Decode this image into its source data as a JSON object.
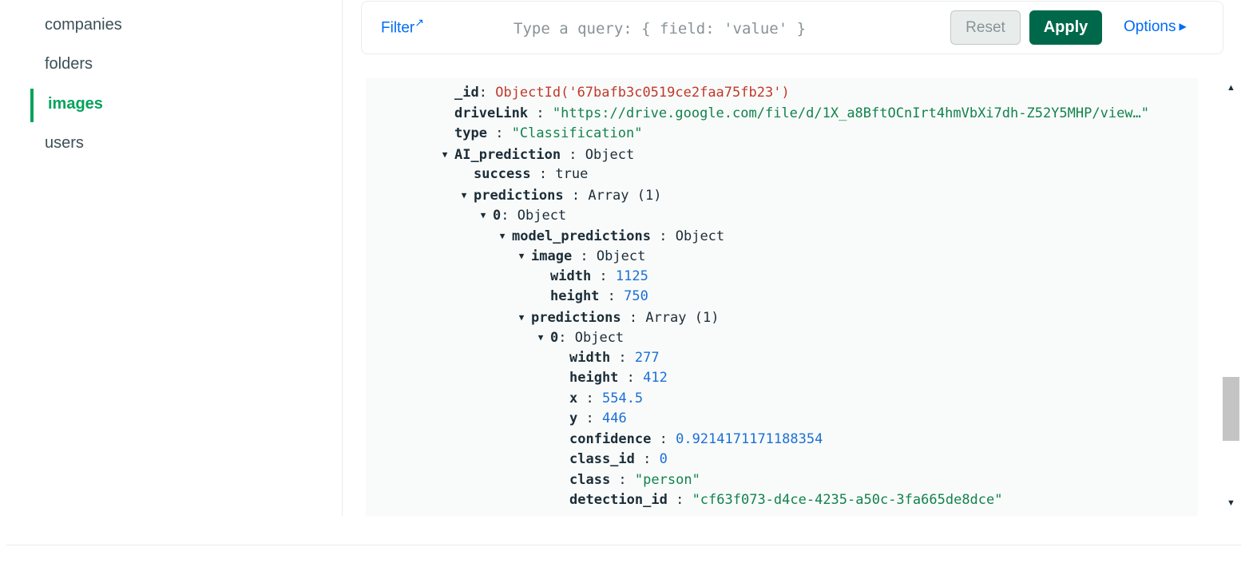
{
  "sidebar": {
    "items": [
      {
        "label": "companies",
        "active": false
      },
      {
        "label": "folders",
        "active": false
      },
      {
        "label": "images",
        "active": true
      },
      {
        "label": "users",
        "active": false
      }
    ]
  },
  "filter": {
    "link_label": "Filter",
    "placeholder": "Type a query: { field: 'value' }",
    "reset_label": "Reset",
    "apply_label": "Apply",
    "options_label": "Options"
  },
  "colors": {
    "accent_green": "#00a35c",
    "apply_green": "#00684a",
    "link_blue": "#016bf8",
    "string_green": "#12824d",
    "number_blue": "#1b6fd6",
    "objectid_red": "#c0392b"
  },
  "document": {
    "lines": [
      {
        "key": "_id",
        "sep": ":",
        "value": "ObjectId('67bafb3c0519ce2faa75fb23')",
        "vtype": "oid",
        "indent": 0,
        "caret": false
      },
      {
        "key": "driveLink",
        "sep": " :",
        "value": "\"https://drive.google.com/file/d/1X_a8BftOCnIrt4hmVbXi7dh-Z52Y5MHP/view…\"",
        "vtype": "str",
        "indent": 0,
        "caret": false
      },
      {
        "key": "type",
        "sep": " :",
        "value": "\"Classification\"",
        "vtype": "str",
        "indent": 0,
        "caret": false
      },
      {
        "key": "AI_prediction",
        "sep": " :",
        "value": "Object",
        "vtype": "plain",
        "indent": 0,
        "caret": true
      },
      {
        "key": "success",
        "sep": " :",
        "value": "true",
        "vtype": "plain",
        "indent": 1,
        "caret": false
      },
      {
        "key": "predictions",
        "sep": " :",
        "value": "Array (1)",
        "vtype": "plain",
        "indent": 1,
        "caret": true
      },
      {
        "key": "0",
        "sep": ":",
        "value": "Object",
        "vtype": "plain",
        "indent": 2,
        "caret": true
      },
      {
        "key": "model_predictions",
        "sep": " :",
        "value": "Object",
        "vtype": "plain",
        "indent": 3,
        "caret": true
      },
      {
        "key": "image",
        "sep": " :",
        "value": "Object",
        "vtype": "plain",
        "indent": 4,
        "caret": true
      },
      {
        "key": "width",
        "sep": " :",
        "value": "1125",
        "vtype": "num",
        "indent": 5,
        "caret": false
      },
      {
        "key": "height",
        "sep": " :",
        "value": "750",
        "vtype": "num",
        "indent": 5,
        "caret": false
      },
      {
        "key": "predictions",
        "sep": " :",
        "value": "Array (1)",
        "vtype": "plain",
        "indent": 4,
        "caret": true
      },
      {
        "key": "0",
        "sep": ":",
        "value": "Object",
        "vtype": "plain",
        "indent": 5,
        "caret": true
      },
      {
        "key": "width",
        "sep": " :",
        "value": "277",
        "vtype": "num",
        "indent": 6,
        "caret": false
      },
      {
        "key": "height",
        "sep": " :",
        "value": "412",
        "vtype": "num",
        "indent": 6,
        "caret": false
      },
      {
        "key": "x",
        "sep": " :",
        "value": "554.5",
        "vtype": "num",
        "indent": 6,
        "caret": false
      },
      {
        "key": "y",
        "sep": " :",
        "value": "446",
        "vtype": "num",
        "indent": 6,
        "caret": false
      },
      {
        "key": "confidence",
        "sep": " :",
        "value": "0.9214171171188354",
        "vtype": "num",
        "indent": 6,
        "caret": false
      },
      {
        "key": "class_id",
        "sep": " :",
        "value": "0",
        "vtype": "num",
        "indent": 6,
        "caret": false
      },
      {
        "key": "class",
        "sep": " :",
        "value": "\"person\"",
        "vtype": "str",
        "indent": 6,
        "caret": false
      },
      {
        "key": "detection_id",
        "sep": " :",
        "value": "\"cf63f073-d4ce-4235-a50c-3fa665de8dce\"",
        "vtype": "str",
        "indent": 6,
        "caret": false
      }
    ]
  }
}
